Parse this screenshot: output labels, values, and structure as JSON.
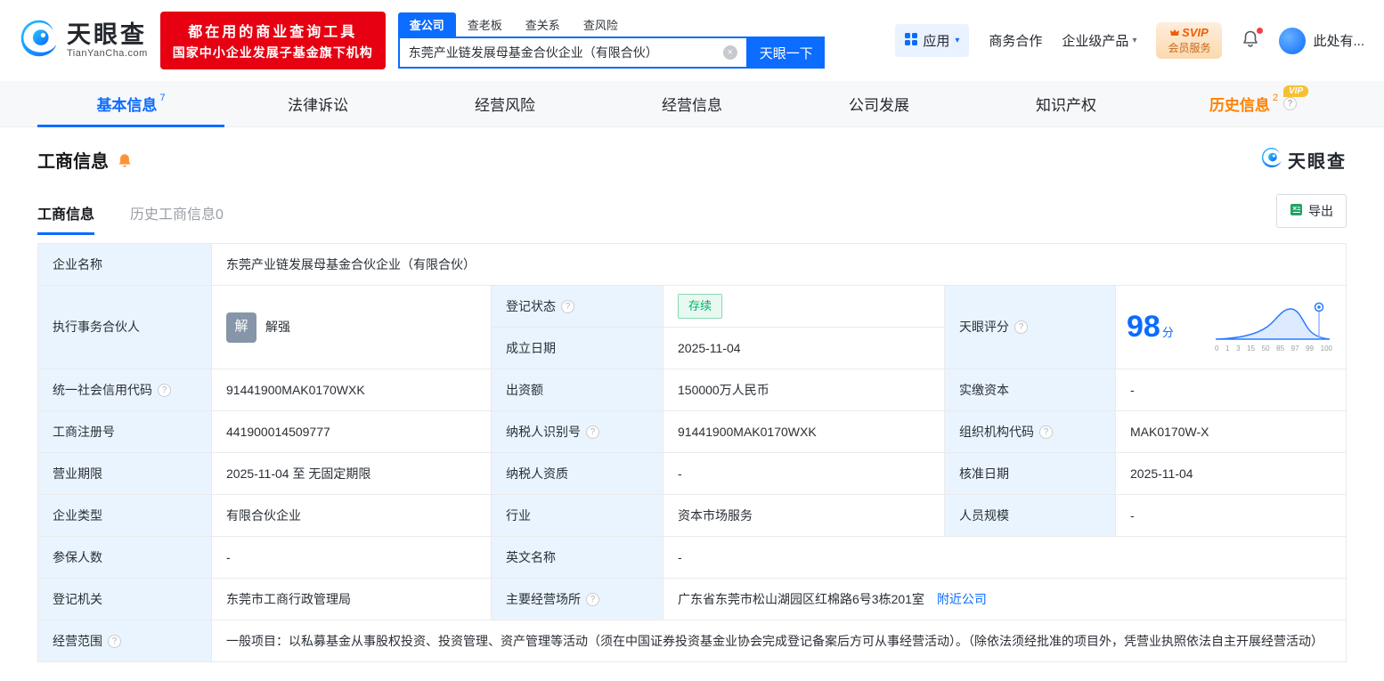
{
  "icons": {
    "clear_glyph": "×",
    "caret_glyph": "▾",
    "help_glyph": "?"
  },
  "colors": {
    "brand_blue": "#0b6cff",
    "banner_red": "#e60012",
    "status_green": "#00b365",
    "history_orange": "#ff8100",
    "label_bg": "#eaf4fe"
  },
  "brand": {
    "name": "天眼查",
    "domain": "TianYanCha.com"
  },
  "banner": {
    "line1": "都在用的商业查询工具",
    "line2": "国家中小企业发展子基金旗下机构"
  },
  "search": {
    "tabs": [
      "查公司",
      "查老板",
      "查关系",
      "查风险"
    ],
    "value": "东莞产业链发展母基金合伙企业（有限合伙）",
    "button": "天眼一下"
  },
  "header_right": {
    "apps": "应用",
    "biz": "商务合作",
    "enterprise": "企业级产品",
    "svip_top": "SVIP",
    "svip_bottom": "会员服务",
    "user": "此处有..."
  },
  "nav": {
    "tabs": [
      {
        "label": "基本信息",
        "count": "7"
      },
      {
        "label": "法律诉讼"
      },
      {
        "label": "经营风险"
      },
      {
        "label": "经营信息"
      },
      {
        "label": "公司发展"
      },
      {
        "label": "知识产权"
      },
      {
        "label": "历史信息",
        "count": "2",
        "vip": "VIP"
      }
    ]
  },
  "section": {
    "title": "工商信息",
    "brand": "天眼查",
    "subtab_active": "工商信息",
    "subtab_history": "历史工商信息0",
    "export_label": "导出"
  },
  "table": {
    "company_name": {
      "label": "企业名称",
      "value": "东莞产业链发展母基金合伙企业（有限合伙）"
    },
    "partner": {
      "label": "执行事务合伙人",
      "avatar": "解",
      "name": "解强"
    },
    "reg_status": {
      "label": "登记状态",
      "value": "存续"
    },
    "establish_date": {
      "label": "成立日期",
      "value": "2025-11-04"
    },
    "score": {
      "label": "天眼评分",
      "value": "98",
      "unit": "分",
      "ticks": [
        "0",
        "1",
        "3",
        "15",
        "50",
        "85",
        "97",
        "99",
        "100"
      ]
    },
    "credit_code": {
      "label": "统一社会信用代码",
      "value": "91441900MAK0170WXK"
    },
    "capital": {
      "label": "出资额",
      "value": "150000万人民币"
    },
    "paid_capital": {
      "label": "实缴资本",
      "value": "-"
    },
    "reg_number": {
      "label": "工商注册号",
      "value": "441900014509777"
    },
    "taxpayer_id": {
      "label": "纳税人识别号",
      "value": "91441900MAK0170WXK"
    },
    "org_code": {
      "label": "组织机构代码",
      "value": "MAK0170W-X"
    },
    "business_term": {
      "label": "营业期限",
      "value": "2025-11-04 至 无固定期限"
    },
    "taxpayer_qualification": {
      "label": "纳税人资质",
      "value": "-"
    },
    "approval_date": {
      "label": "核准日期",
      "value": "2025-11-04"
    },
    "company_type": {
      "label": "企业类型",
      "value": "有限合伙企业"
    },
    "industry": {
      "label": "行业",
      "value": "资本市场服务"
    },
    "staff_size": {
      "label": "人员规模",
      "value": "-"
    },
    "insured_count": {
      "label": "参保人数",
      "value": "-"
    },
    "english_name": {
      "label": "英文名称",
      "value": "-"
    },
    "registry": {
      "label": "登记机关",
      "value": "东莞市工商行政管理局"
    },
    "address": {
      "label": "主要经营场所",
      "value": "广东省东莞市松山湖园区红棉路6号3栋201室",
      "link": "附近公司"
    },
    "business_scope": {
      "label": "经营范围",
      "value": "一般项目：以私募基金从事股权投资、投资管理、资产管理等活动（须在中国证券投资基金业协会完成登记备案后方可从事经营活动）。（除依法须经批准的项目外，凭营业执照依法自主开展经营活动）"
    }
  }
}
